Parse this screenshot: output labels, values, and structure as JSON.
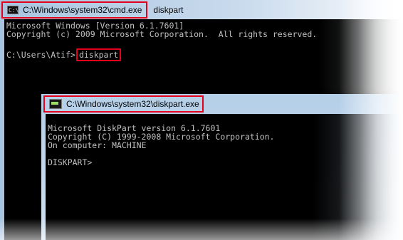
{
  "back_window": {
    "title": "C:\\Windows\\system32\\cmd.exe",
    "title_suffix": "diskpart",
    "icon": "cmd-icon",
    "console": {
      "lines": [
        "Microsoft Windows [Version 6.1.7601]",
        "Copyright (c) 2009 Microsoft Corporation.  All rights reserved."
      ],
      "prompt": "C:\\Users\\Atif>",
      "command": "diskpart"
    }
  },
  "front_window": {
    "title": "C:\\Windows\\system32\\diskpart.exe",
    "icon": "diskpart-icon",
    "console": {
      "lines": [
        "Microsoft DiskPart version 6.1.7601",
        "Copyright (C) 1999-2008 Microsoft Corporation.",
        "On computer: MACHINE"
      ],
      "prompt": "DISKPART>"
    }
  },
  "colors": {
    "highlight": "#e3001b",
    "console_bg": "#000000",
    "console_text": "#c0c0c0"
  }
}
